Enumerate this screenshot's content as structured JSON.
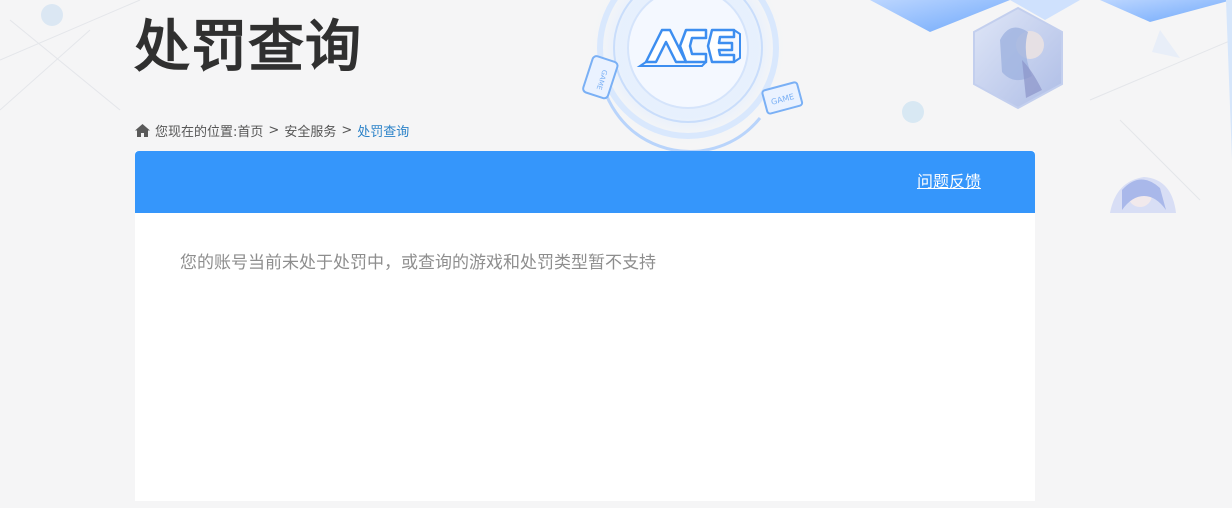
{
  "page": {
    "title": "处罚查询"
  },
  "logo": {
    "text": "ACE",
    "badge_left": "GAME",
    "badge_right": "GAME"
  },
  "breadcrumb": {
    "prefix": "您现在的位置:",
    "items": [
      "首页",
      "安全服务"
    ],
    "separator": ">",
    "current": "处罚查询"
  },
  "panel": {
    "feedback_label": "问题反馈",
    "message": "您的账号当前未处于处罚中，或查询的游戏和处罚类型暂不支持"
  },
  "colors": {
    "header_blue": "#3596fb",
    "breadcrumb_current": "#2b82c8",
    "title": "#303030",
    "message": "#8e8e8e"
  },
  "icons": [
    "home-icon",
    "ace-logo-icon",
    "game-badge-icon",
    "character-avatar-icon"
  ]
}
